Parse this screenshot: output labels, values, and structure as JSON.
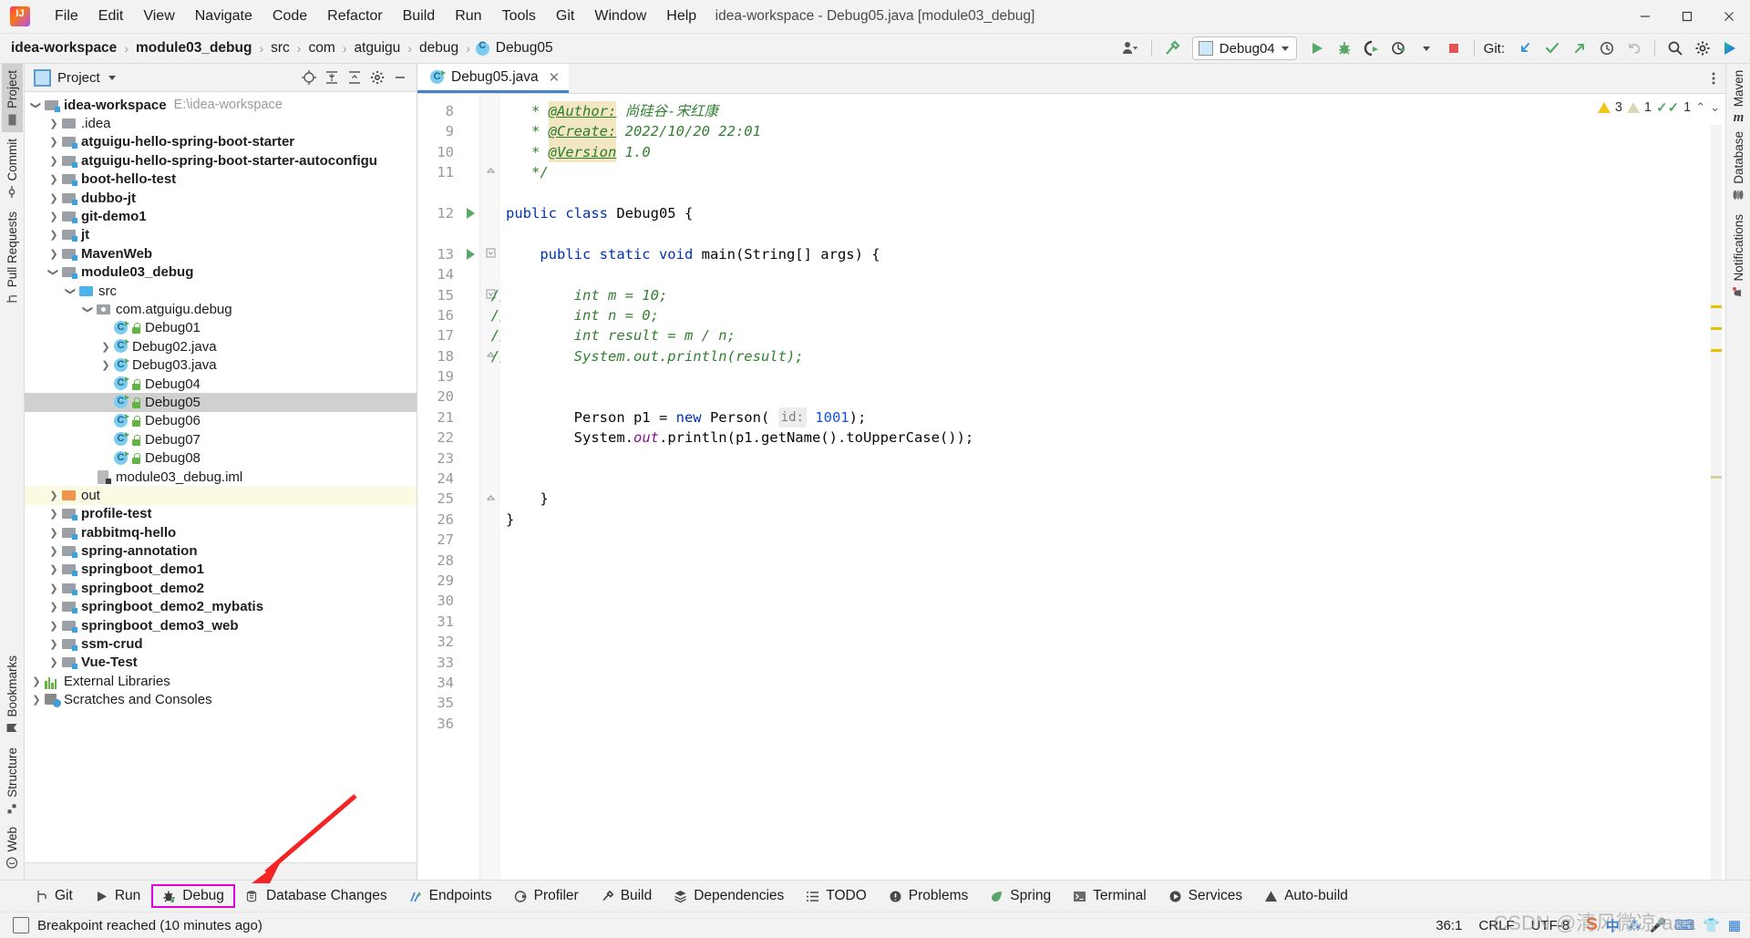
{
  "window": {
    "title": "idea-workspace - Debug05.java [module03_debug]",
    "minimize_label": "—",
    "maximize_label": "❐",
    "close_label": "✕"
  },
  "menubar": {
    "items": [
      {
        "label": "File",
        "mnemonic": "F"
      },
      {
        "label": "Edit",
        "mnemonic": "E"
      },
      {
        "label": "View",
        "mnemonic": "V"
      },
      {
        "label": "Navigate",
        "mnemonic": "N"
      },
      {
        "label": "Code",
        "mnemonic": "C"
      },
      {
        "label": "Refactor",
        "mnemonic": "R"
      },
      {
        "label": "Build",
        "mnemonic": "B"
      },
      {
        "label": "Run",
        "mnemonic": "u"
      },
      {
        "label": "Tools",
        "mnemonic": "T"
      },
      {
        "label": "Git",
        "mnemonic": "G"
      },
      {
        "label": "Window",
        "mnemonic": "W"
      },
      {
        "label": "Help",
        "mnemonic": "H"
      }
    ]
  },
  "breadcrumb": {
    "segments": [
      "idea-workspace",
      "module03_debug",
      "src",
      "com",
      "atguigu",
      "debug"
    ],
    "last": "Debug05",
    "separator": "›"
  },
  "toolbar": {
    "run_config": "Debug04",
    "git_label": "Git:",
    "icons": [
      "user-dropdown-icon",
      "hammer-build-icon",
      "run-icon",
      "debug-icon",
      "run-coverage-icon",
      "profile-icon",
      "stop-icon",
      "git-update-icon",
      "git-commit-icon",
      "git-push-icon",
      "git-history-icon",
      "git-rollback-icon",
      "search-everywhere-icon",
      "settings-icon",
      "ide-assistant-icon"
    ]
  },
  "left_strip": {
    "top": [
      "Project",
      "Commit",
      "Pull Requests"
    ],
    "bottom": [
      "Bookmarks",
      "Structure",
      "Web"
    ],
    "active": "Project"
  },
  "right_strip": {
    "items": [
      "Maven",
      "Database",
      "Notifications"
    ]
  },
  "project_panel": {
    "title": "Project",
    "tools": [
      "locate-icon",
      "expand-all-icon",
      "collapse-all-icon",
      "settings-icon",
      "hide-icon"
    ],
    "tree": [
      {
        "label": "idea-workspace",
        "path": "E:\\idea-workspace",
        "indent": 0,
        "state": "expanded",
        "icon": "module-folder-icon",
        "bold": true
      },
      {
        "label": ".idea",
        "indent": 1,
        "state": "collapsed",
        "icon": "folder-icon",
        "bold": false
      },
      {
        "label": "atguigu-hello-spring-boot-starter",
        "indent": 1,
        "state": "collapsed",
        "icon": "module-folder-icon",
        "bold": true
      },
      {
        "label": "atguigu-hello-spring-boot-starter-autoconfigu",
        "indent": 1,
        "state": "collapsed",
        "icon": "module-folder-icon",
        "bold": true
      },
      {
        "label": "boot-hello-test",
        "indent": 1,
        "state": "collapsed",
        "icon": "module-folder-icon",
        "bold": true
      },
      {
        "label": "dubbo-jt",
        "indent": 1,
        "state": "collapsed",
        "icon": "module-folder-icon",
        "bold": true
      },
      {
        "label": "git-demo1",
        "indent": 1,
        "state": "collapsed",
        "icon": "module-folder-icon",
        "bold": true
      },
      {
        "label": "jt",
        "indent": 1,
        "state": "collapsed",
        "icon": "module-folder-icon",
        "bold": true
      },
      {
        "label": "MavenWeb",
        "indent": 1,
        "state": "collapsed",
        "icon": "module-folder-icon",
        "bold": true
      },
      {
        "label": "module03_debug",
        "indent": 1,
        "state": "expanded",
        "icon": "module-folder-icon",
        "bold": true
      },
      {
        "label": "src",
        "indent": 2,
        "state": "expanded",
        "icon": "source-folder-icon",
        "bold": false
      },
      {
        "label": "com.atguigu.debug",
        "indent": 3,
        "state": "expanded",
        "icon": "package-icon",
        "bold": false
      },
      {
        "label": "Debug01",
        "indent": 4,
        "state": "leaf",
        "icon": "java-class-icon",
        "lock": true,
        "bold": false
      },
      {
        "label": "Debug02.java",
        "indent": 4,
        "state": "collapsed",
        "icon": "java-class-icon",
        "lock": false,
        "bold": false
      },
      {
        "label": "Debug03.java",
        "indent": 4,
        "state": "collapsed",
        "icon": "java-class-icon",
        "lock": false,
        "bold": false
      },
      {
        "label": "Debug04",
        "indent": 4,
        "state": "leaf",
        "icon": "java-class-icon",
        "lock": true,
        "bold": false
      },
      {
        "label": "Debug05",
        "indent": 4,
        "state": "leaf",
        "icon": "java-class-icon",
        "lock": true,
        "bold": false,
        "selected": true
      },
      {
        "label": "Debug06",
        "indent": 4,
        "state": "leaf",
        "icon": "java-class-icon",
        "lock": true,
        "bold": false
      },
      {
        "label": "Debug07",
        "indent": 4,
        "state": "leaf",
        "icon": "java-class-icon",
        "lock": true,
        "bold": false
      },
      {
        "label": "Debug08",
        "indent": 4,
        "state": "leaf",
        "icon": "java-class-icon",
        "lock": true,
        "bold": false
      },
      {
        "label": "module03_debug.iml",
        "indent": 3,
        "state": "leaf",
        "icon": "iml-file-icon",
        "bold": false
      },
      {
        "label": "out",
        "indent": 1,
        "state": "collapsed",
        "icon": "out-folder-icon",
        "bold": false,
        "highlight": true
      },
      {
        "label": "profile-test",
        "indent": 1,
        "state": "collapsed",
        "icon": "module-folder-icon",
        "bold": true
      },
      {
        "label": "rabbitmq-hello",
        "indent": 1,
        "state": "collapsed",
        "icon": "module-folder-icon",
        "bold": true
      },
      {
        "label": "spring-annotation",
        "indent": 1,
        "state": "collapsed",
        "icon": "module-folder-icon",
        "bold": true
      },
      {
        "label": "springboot_demo1",
        "indent": 1,
        "state": "collapsed",
        "icon": "module-folder-icon",
        "bold": true
      },
      {
        "label": "springboot_demo2",
        "indent": 1,
        "state": "collapsed",
        "icon": "module-folder-icon",
        "bold": true
      },
      {
        "label": "springboot_demo2_mybatis",
        "indent": 1,
        "state": "collapsed",
        "icon": "module-folder-icon",
        "bold": true
      },
      {
        "label": "springboot_demo3_web",
        "indent": 1,
        "state": "collapsed",
        "icon": "module-folder-icon",
        "bold": true
      },
      {
        "label": "ssm-crud",
        "indent": 1,
        "state": "collapsed",
        "icon": "module-folder-icon",
        "bold": true
      },
      {
        "label": "Vue-Test",
        "indent": 1,
        "state": "collapsed",
        "icon": "module-folder-icon",
        "bold": true
      },
      {
        "label": "External Libraries",
        "indent": 0,
        "state": "collapsed",
        "icon": "libraries-icon",
        "bold": false
      },
      {
        "label": "Scratches and Consoles",
        "indent": 0,
        "state": "collapsed",
        "icon": "scratches-icon",
        "bold": false
      }
    ]
  },
  "editor": {
    "tab": {
      "label": "Debug05.java",
      "icon": "java-class-icon",
      "close": "✕"
    },
    "lines": [
      {
        "n": 8,
        "fold": "",
        "run": false,
        "tokens": [
          {
            "t": "   * ",
            "c": "doc"
          },
          {
            "t": "@Author:",
            "c": "doctag"
          },
          {
            "t": " 尚硅谷-宋红康",
            "c": "docval"
          }
        ]
      },
      {
        "n": 9,
        "fold": "",
        "run": false,
        "tokens": [
          {
            "t": "   * ",
            "c": "doc"
          },
          {
            "t": "@Create:",
            "c": "doctag"
          },
          {
            "t": " 2022/10/20 22:01",
            "c": "docval"
          }
        ]
      },
      {
        "n": 10,
        "fold": "",
        "run": false,
        "tokens": [
          {
            "t": "   * ",
            "c": "doc"
          },
          {
            "t": "@Version",
            "c": "doctag"
          },
          {
            "t": " 1.0",
            "c": "docval"
          }
        ]
      },
      {
        "n": 11,
        "fold": "end",
        "run": false,
        "tokens": [
          {
            "t": "   */",
            "c": "doc"
          }
        ]
      },
      {
        "n": "",
        "fold": "",
        "run": false,
        "tokens": []
      },
      {
        "n": 12,
        "fold": "",
        "run": true,
        "tokens": [
          {
            "t": "public class",
            "c": "kw"
          },
          {
            "t": " Debug05 {",
            "c": "plain"
          }
        ]
      },
      {
        "n": "",
        "fold": "",
        "run": false,
        "tokens": []
      },
      {
        "n": 13,
        "fold": "start",
        "run": true,
        "tokens": [
          {
            "t": "    ",
            "c": "plain"
          },
          {
            "t": "public static void",
            "c": "kw"
          },
          {
            "t": " main(String[] args) {",
            "c": "plain"
          }
        ]
      },
      {
        "n": 14,
        "fold": "",
        "run": false,
        "tokens": []
      },
      {
        "n": 15,
        "fold": "start",
        "run": false,
        "comment_prefix": "//",
        "tokens": [
          {
            "t": "        int m = 10;",
            "c": "cmt-green"
          }
        ]
      },
      {
        "n": 16,
        "fold": "",
        "run": false,
        "comment_prefix": "//",
        "tokens": [
          {
            "t": "        int n = 0;",
            "c": "cmt-green"
          }
        ]
      },
      {
        "n": 17,
        "fold": "",
        "run": false,
        "comment_prefix": "//",
        "tokens": [
          {
            "t": "        int result = m / n;",
            "c": "cmt-green"
          }
        ]
      },
      {
        "n": 18,
        "fold": "end",
        "run": false,
        "comment_prefix": "//",
        "tokens": [
          {
            "t": "        System.out.println(result);",
            "c": "cmt-green"
          }
        ]
      },
      {
        "n": 19,
        "fold": "",
        "run": false,
        "tokens": []
      },
      {
        "n": 20,
        "fold": "",
        "run": false,
        "tokens": []
      },
      {
        "n": 21,
        "fold": "",
        "run": false,
        "tokens": [
          {
            "t": "        Person p1 = ",
            "c": "plain"
          },
          {
            "t": "new",
            "c": "kw"
          },
          {
            "t": " Person( ",
            "c": "plain"
          },
          {
            "t": "id:",
            "c": "hint"
          },
          {
            "t": " ",
            "c": "plain"
          },
          {
            "t": "1001",
            "c": "num"
          },
          {
            "t": ");",
            "c": "plain"
          }
        ]
      },
      {
        "n": 22,
        "fold": "",
        "run": false,
        "tokens": [
          {
            "t": "        System.",
            "c": "plain"
          },
          {
            "t": "out",
            "c": "fld"
          },
          {
            "t": ".println(p1.getName().toUpperCase());",
            "c": "plain"
          }
        ]
      },
      {
        "n": 23,
        "fold": "",
        "run": false,
        "tokens": []
      },
      {
        "n": 24,
        "fold": "",
        "run": false,
        "tokens": []
      },
      {
        "n": 25,
        "fold": "end",
        "run": false,
        "tokens": [
          {
            "t": "    }",
            "c": "plain"
          }
        ]
      },
      {
        "n": 26,
        "fold": "",
        "run": false,
        "tokens": [
          {
            "t": "}",
            "c": "plain"
          }
        ]
      },
      {
        "n": 27,
        "fold": "",
        "run": false,
        "tokens": []
      },
      {
        "n": 28,
        "fold": "",
        "run": false,
        "tokens": []
      },
      {
        "n": 29,
        "fold": "",
        "run": false,
        "tokens": []
      },
      {
        "n": 30,
        "fold": "",
        "run": false,
        "tokens": []
      },
      {
        "n": 31,
        "fold": "",
        "run": false,
        "tokens": []
      },
      {
        "n": 32,
        "fold": "",
        "run": false,
        "tokens": []
      },
      {
        "n": 33,
        "fold": "",
        "run": false,
        "tokens": []
      },
      {
        "n": 34,
        "fold": "",
        "run": false,
        "tokens": []
      },
      {
        "n": 35,
        "fold": "",
        "run": false,
        "tokens": []
      },
      {
        "n": 36,
        "fold": "",
        "run": false,
        "tokens": []
      }
    ],
    "inspections": {
      "warnings": "3",
      "weak_warnings": "1",
      "ok_count": "1",
      "up_label": "⌃",
      "down_label": "⌄"
    }
  },
  "bottom_tools": [
    {
      "label": "Git",
      "icon": "git-branch-icon"
    },
    {
      "label": "Run",
      "icon": "run-icon"
    },
    {
      "label": "Debug",
      "icon": "debug-bug-icon",
      "highlighted": true
    },
    {
      "label": "Database Changes",
      "icon": "database-changes-icon"
    },
    {
      "label": "Endpoints",
      "icon": "endpoints-icon"
    },
    {
      "label": "Profiler",
      "icon": "profiler-icon"
    },
    {
      "label": "Build",
      "icon": "build-hammer-icon"
    },
    {
      "label": "Dependencies",
      "icon": "dependencies-icon"
    },
    {
      "label": "TODO",
      "icon": "todo-list-icon"
    },
    {
      "label": "Problems",
      "icon": "problems-icon"
    },
    {
      "label": "Spring",
      "icon": "spring-leaf-icon"
    },
    {
      "label": "Terminal",
      "icon": "terminal-icon"
    },
    {
      "label": "Services",
      "icon": "services-icon"
    },
    {
      "label": "Auto-build",
      "icon": "auto-build-icon"
    }
  ],
  "statusbar": {
    "message": "Breakpoint reached (10 minutes ago)",
    "caret": "36:1",
    "line_sep": "CRLF",
    "encoding": "UTF-8",
    "watermark": "CSDN @清风微凉 aaa",
    "tray": [
      "sogou-icon",
      "ime-cn-icon",
      "ime-dot-icon",
      "ime-mic-icon",
      "ime-keyboard-icon",
      "ime-shirt-icon",
      "ime-grid-icon"
    ]
  }
}
